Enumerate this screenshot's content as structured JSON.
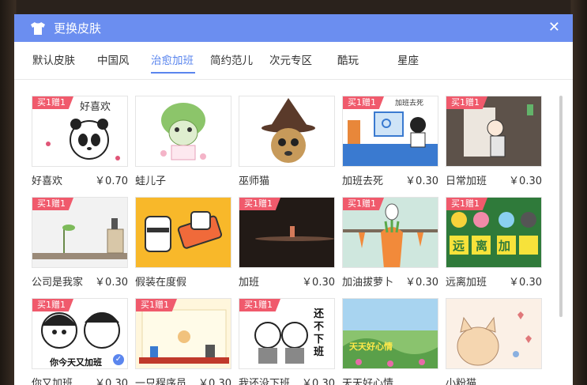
{
  "dialog": {
    "title": "更换皮肤",
    "close_glyph": "✕"
  },
  "tabs": [
    {
      "label": "默认皮肤",
      "active": false
    },
    {
      "label": "中国风",
      "active": false
    },
    {
      "label": "治愈加班",
      "active": true
    },
    {
      "label": "简约范儿",
      "active": false
    },
    {
      "label": "次元专区",
      "active": false
    },
    {
      "label": "酷玩",
      "active": false
    },
    {
      "label": "星座",
      "active": false
    }
  ],
  "skins": [
    {
      "name": "好喜欢",
      "price": "￥0.70",
      "badge": "买1赠1",
      "selected": false,
      "thumb_text": "好喜欢",
      "bg": "#ffffff"
    },
    {
      "name": "蛙儿子",
      "price": "",
      "badge": "",
      "selected": false,
      "thumb_text": "",
      "bg": "#ffffff"
    },
    {
      "name": "巫师猫",
      "price": "",
      "badge": "",
      "selected": false,
      "thumb_text": "",
      "bg": "#ffffff"
    },
    {
      "name": "加班去死",
      "price": "￥0.30",
      "badge": "买1赠1",
      "selected": false,
      "thumb_text": "加班去死",
      "bg": "#ffffff"
    },
    {
      "name": "日常加班",
      "price": "￥0.30",
      "badge": "买1赠1",
      "selected": false,
      "thumb_text": "",
      "bg": "#5d524a"
    },
    {
      "name": "公司是我家",
      "price": "￥0.30",
      "badge": "买1赠1",
      "selected": false,
      "thumb_text": "",
      "bg": "#f2f2f2"
    },
    {
      "name": "假装在度假",
      "price": "",
      "badge": "",
      "selected": false,
      "thumb_text": "",
      "bg": "#f8b82a"
    },
    {
      "name": "加班",
      "price": "￥0.30",
      "badge": "买1赠1",
      "selected": false,
      "thumb_text": "",
      "bg": "#221a16"
    },
    {
      "name": "加油拔萝卜",
      "price": "￥0.30",
      "badge": "买1赠1",
      "selected": false,
      "thumb_text": "",
      "bg": "#cfe7de"
    },
    {
      "name": "远离加班",
      "price": "￥0.30",
      "badge": "买1赠1",
      "selected": false,
      "thumb_text": "远离加班",
      "bg": "#2f7a3a"
    },
    {
      "name": "你又加班",
      "price": "￥0.30",
      "badge": "买1赠1",
      "selected": true,
      "thumb_text": "你今天又加班",
      "bg": "#ffffff"
    },
    {
      "name": "一只程序员",
      "price": "￥0.30",
      "badge": "买1赠1",
      "selected": false,
      "thumb_text": "",
      "bg": "#fff6dc"
    },
    {
      "name": "我还没下班",
      "price": "￥0.30",
      "badge": "买1赠1",
      "selected": false,
      "thumb_text": "还不下班",
      "bg": "#ffffff"
    },
    {
      "name": "天天好心情",
      "price": "",
      "badge": "",
      "selected": false,
      "thumb_text": "天天好心情",
      "bg": "#8ac36e"
    },
    {
      "name": "小粉猫",
      "price": "",
      "badge": "",
      "selected": false,
      "thumb_text": "",
      "bg": "#fbf0e6"
    }
  ]
}
